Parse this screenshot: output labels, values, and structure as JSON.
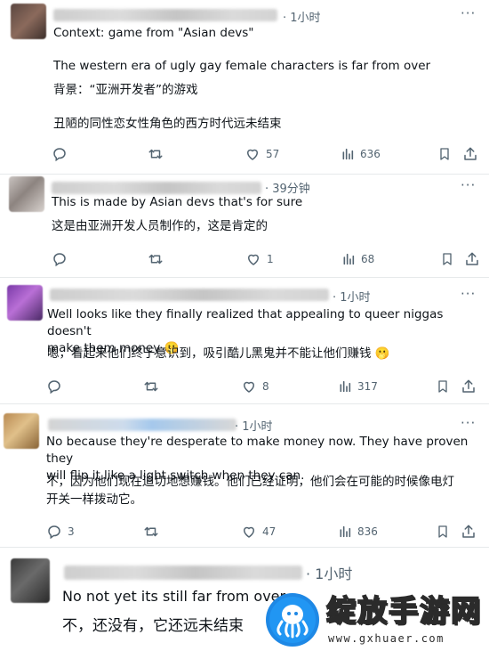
{
  "posts": [
    {
      "time": "· 1小时",
      "text_en": [
        "Context: game from \"Asian devs\"",
        "",
        "The western era of ugly gay female characters is far from over"
      ],
      "text_zh": [
        "背景：“亚洲开发者”的游戏",
        "",
        "丑陋的同性恋女性角色的西方时代远未结束"
      ],
      "replies": "",
      "retweets": "",
      "likes": "57",
      "views": "636"
    },
    {
      "time": "· 39分钟",
      "text_en": [
        "This is made by Asian devs that's for sure"
      ],
      "text_zh": [
        "这是由亚洲开发人员制作的，这是肯定的"
      ],
      "replies": "",
      "retweets": "",
      "likes": "1",
      "views": "68"
    },
    {
      "time": "· 1小时",
      "text_en": [
        "Well looks like they finally realized that appealing to queer niggas doesn't",
        "make them money 🫢"
      ],
      "text_zh": [
        "嗯，看起来他们终于意识到，吸引酷儿黑鬼并不能让他们赚钱 🫢"
      ],
      "replies": "",
      "retweets": "",
      "likes": "8",
      "views": "317"
    },
    {
      "time": "· 1小时",
      "text_en": [
        "No because they're desperate to make money now. They have proven they",
        "will flip it like a light switch when they can."
      ],
      "text_zh": [
        "不，因为他们现在迫切地想赚钱。他们已经证明，他们会在可能的时候像电灯",
        "开关一样拨动它。"
      ],
      "replies": "3",
      "retweets": "",
      "likes": "47",
      "views": "836"
    },
    {
      "time": "· 1小时",
      "text_en": [
        "No not yet its still far from over"
      ],
      "text_zh": [
        "不，还没有，它还远未结束"
      ]
    }
  ],
  "more_glyph": "···",
  "watermark": {
    "title": "绽放手游网",
    "url": "www.gxhuaer.com"
  },
  "colors": {
    "text": "#0f1419",
    "muted": "#536471",
    "separator": "#e6e9eb",
    "watermark_brand": "#1e88e5"
  },
  "icons": [
    "reply-icon",
    "retweet-icon",
    "like-icon",
    "views-icon",
    "bookmark-icon",
    "share-icon",
    "more-icon"
  ]
}
